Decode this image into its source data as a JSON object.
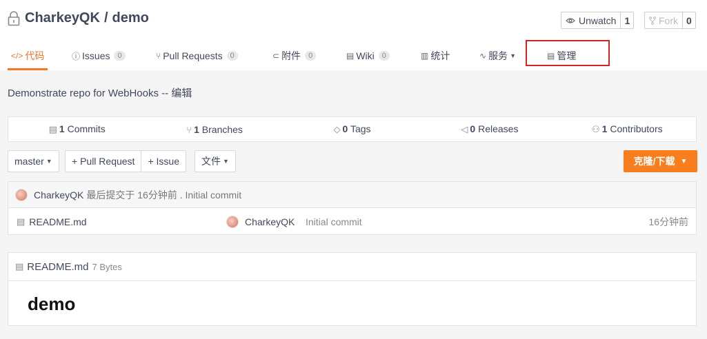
{
  "repo": {
    "owner": "CharkeyQK",
    "separator": "/",
    "name": "demo"
  },
  "watch": {
    "label": "Unwatch",
    "count": "1"
  },
  "fork": {
    "label": "Fork",
    "count": "0"
  },
  "tabs": [
    {
      "label": "代码",
      "icon": "code-icon"
    },
    {
      "label": "Issues",
      "badge": "0",
      "icon": "issue-icon"
    },
    {
      "label": "Pull Requests",
      "badge": "0",
      "icon": "pull-request-icon"
    },
    {
      "label": "附件",
      "badge": "0",
      "icon": "attachment-icon"
    },
    {
      "label": "Wiki",
      "badge": "0",
      "icon": "book-icon"
    },
    {
      "label": "统计",
      "icon": "chart-icon"
    },
    {
      "label": "服务",
      "icon": "pulse-icon"
    },
    {
      "label": "管理",
      "icon": "settings-doc-icon"
    }
  ],
  "description": {
    "text": "Demonstrate repo for WebHooks --",
    "edit_link": "编辑"
  },
  "stats": [
    {
      "count": "1",
      "label": "Commits"
    },
    {
      "count": "1",
      "label": "Branches"
    },
    {
      "count": "0",
      "label": "Tags"
    },
    {
      "count": "0",
      "label": "Releases"
    },
    {
      "count": "1",
      "label": "Contributors"
    }
  ],
  "toolbar": {
    "branch": "master",
    "pull_request": "+ Pull Request",
    "issue": "+ Issue",
    "file": "文件",
    "clone": "克隆/下载"
  },
  "last_commit": {
    "author": "CharkeyQK",
    "meta": "最后提交于 16分钟前 . Initial commit"
  },
  "files": [
    {
      "name": "README.md",
      "author": "CharkeyQK",
      "message": "Initial commit",
      "time": "16分钟前"
    }
  ],
  "readme": {
    "title": "README.md",
    "size": "7 Bytes",
    "heading": "demo"
  },
  "colors": {
    "accent": "#f5752a",
    "clone_button": "#f87d1c",
    "highlight": "#d02525"
  }
}
